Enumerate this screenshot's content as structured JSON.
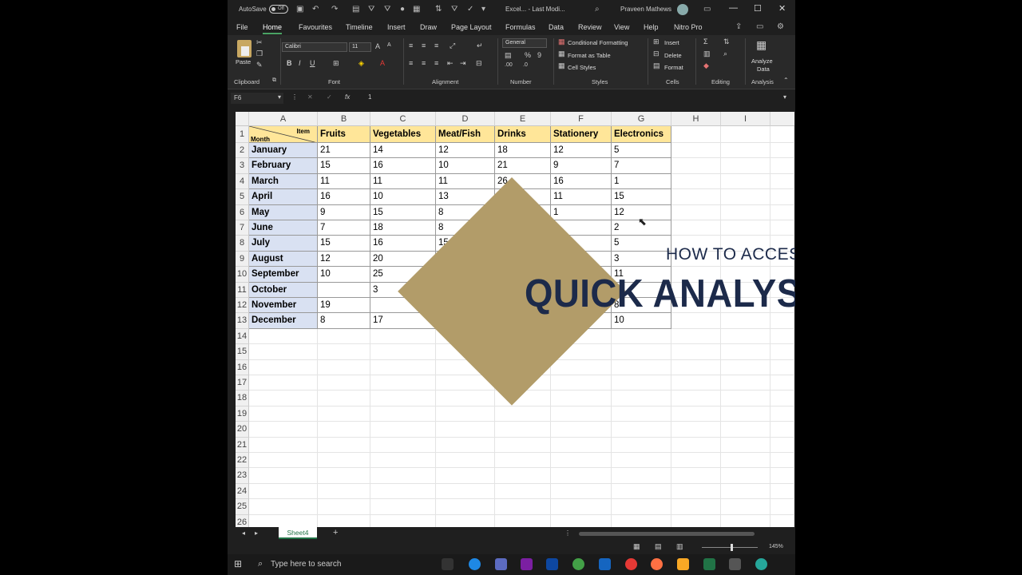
{
  "titlebar": {
    "autosave": "AutoSave",
    "toggle": "Off",
    "doc_title": "Excel... - Last Modi...",
    "user": "Praveen Mathews",
    "min": "—",
    "max": "☐",
    "close": "✕"
  },
  "tabs": [
    "File",
    "Home",
    "Favourites",
    "Timeline",
    "Insert",
    "Draw",
    "Page Layout",
    "Formulas",
    "Data",
    "Review",
    "View",
    "Help",
    "Nitro Pro"
  ],
  "ribbon": {
    "paste": "Paste",
    "font_name": "Calibri",
    "font_size": "11",
    "number_format": "General",
    "conditional": "Conditional Formatting",
    "format_table": "Format as Table",
    "cell_styles": "Cell Styles",
    "insert": "Insert",
    "delete": "Delete",
    "format": "Format",
    "analyze": "Analyze",
    "analyze_data": "Data",
    "groups": [
      "Clipboard",
      "Font",
      "Alignment",
      "Number",
      "Styles",
      "Cells",
      "Editing",
      "Analysis"
    ]
  },
  "formula": {
    "namebox": "F6",
    "fx": "fx",
    "value": "1"
  },
  "columns": [
    "A",
    "B",
    "C",
    "D",
    "E",
    "F",
    "G",
    "H",
    "I"
  ],
  "row_numbers": [
    "1",
    "2",
    "3",
    "4",
    "5",
    "6",
    "7",
    "8",
    "9",
    "10",
    "11",
    "12",
    "13",
    "14",
    "15",
    "16",
    "17",
    "18",
    "19",
    "20",
    "21",
    "22",
    "23",
    "24",
    "25",
    "26"
  ],
  "table": {
    "corner_item": "Item",
    "corner_month": "Month",
    "headers": [
      "Fruits",
      "Vegetables",
      "Meat/Fish",
      "Drinks",
      "Stationery",
      "Electronics"
    ],
    "rows": [
      [
        "January",
        "21",
        "14",
        "12",
        "18",
        "12",
        "5"
      ],
      [
        "February",
        "15",
        "16",
        "10",
        "21",
        "9",
        "7"
      ],
      [
        "March",
        "11",
        "11",
        "11",
        "26",
        "16",
        "1"
      ],
      [
        "April",
        "16",
        "10",
        "13",
        "",
        "11",
        "15"
      ],
      [
        "May",
        "9",
        "15",
        "8",
        "",
        "1",
        "12"
      ],
      [
        "June",
        "7",
        "18",
        "8",
        "",
        "",
        "2"
      ],
      [
        "July",
        "15",
        "16",
        "15",
        "",
        "",
        "5"
      ],
      [
        "August",
        "12",
        "20",
        "",
        "",
        "",
        "3"
      ],
      [
        "September",
        "10",
        "25",
        "",
        "",
        "",
        "11"
      ],
      [
        "October",
        "",
        "3",
        "",
        "",
        "",
        ""
      ],
      [
        "November",
        "19",
        "",
        "",
        "",
        "",
        "8"
      ],
      [
        "December",
        "8",
        "17",
        "",
        "",
        "",
        "10"
      ]
    ]
  },
  "overlay": {
    "subtitle": "HOW TO ACCESS",
    "title": "QUICK ANALYSIS TOOL",
    "diamond_color": "#b29c69",
    "text_color": "#1c2a4a"
  },
  "sheet": {
    "tab": "Sheet4",
    "add": "+"
  },
  "status": {
    "zoom": "145%"
  },
  "taskbar": {
    "search": "Type here to search"
  }
}
